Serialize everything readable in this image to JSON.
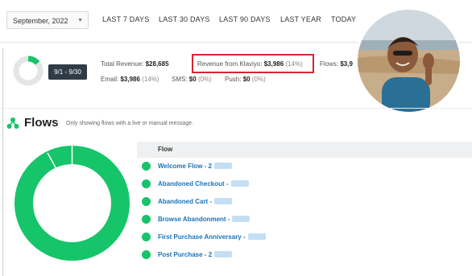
{
  "filters": {
    "month": "September, 2022",
    "ranges": [
      "LAST 7 DAYS",
      "LAST 30 DAYS",
      "LAST 90 DAYS",
      "LAST YEAR",
      "TODAY"
    ]
  },
  "summary": {
    "date_range": "9/1 - 9/30",
    "total_revenue_label": "Total Revenue:",
    "total_revenue_value": "$28,685",
    "klaviyo_label": "Revenue from Klaviyo:",
    "klaviyo_value": "$3,986",
    "klaviyo_pct": "(14%)",
    "flows_label": "Flows:",
    "flows_value": "$3,9",
    "email_label": "Email:",
    "email_value": "$3,986",
    "email_pct": "(14%)",
    "sms_label": "SMS:",
    "sms_value": "$0",
    "sms_pct": "(0%)",
    "push_label": "Push:",
    "push_value": "$0",
    "push_pct": "(0%)",
    "klaviyo_share": 0.14
  },
  "flows": {
    "title": "Flows",
    "note": "Only showing flows with a live or manual message.",
    "column_header": "Flow",
    "items": [
      "Welcome Flow - 2",
      "Abandoned Checkout -",
      "Abandoned Cart -",
      "Browse Abandonment -",
      "First Purchase Anniversary -",
      "Post Purchase - 2"
    ]
  },
  "colors": {
    "accent_green": "#16c46a",
    "link_blue": "#1a73b8",
    "highlight_red": "#d6262b",
    "pill_dark": "#2f3b45"
  },
  "icons": {
    "flows": "flows-icon",
    "dropdown": "chevron-down-icon"
  }
}
